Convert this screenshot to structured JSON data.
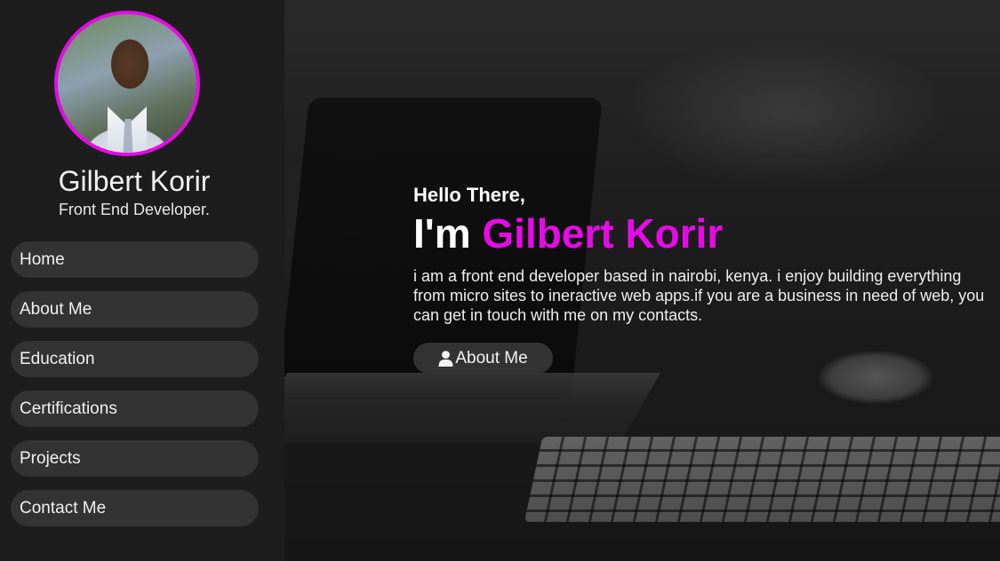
{
  "profile": {
    "name": "Gilbert Korir",
    "role": "Front End Developer."
  },
  "nav": {
    "items": [
      {
        "label": "Home"
      },
      {
        "label": "About Me"
      },
      {
        "label": "Education"
      },
      {
        "label": "Certifications"
      },
      {
        "label": "Projects"
      },
      {
        "label": "Contact Me"
      }
    ]
  },
  "hero": {
    "greeting": "Hello There,",
    "prefix": "I'm ",
    "name": "Gilbert Korir",
    "intro": "i am a front end developer based in nairobi, kenya. i enjoy building everything from micro sites to ineractive web apps.if you are a business in need of web, you can get in touch with me on my contacts.",
    "button_label": "About Me",
    "button_icon": "user-icon"
  },
  "colors": {
    "accent": "#e60be6",
    "sidebar_bg": "#1d1d1d",
    "button_bg": "#333333"
  }
}
